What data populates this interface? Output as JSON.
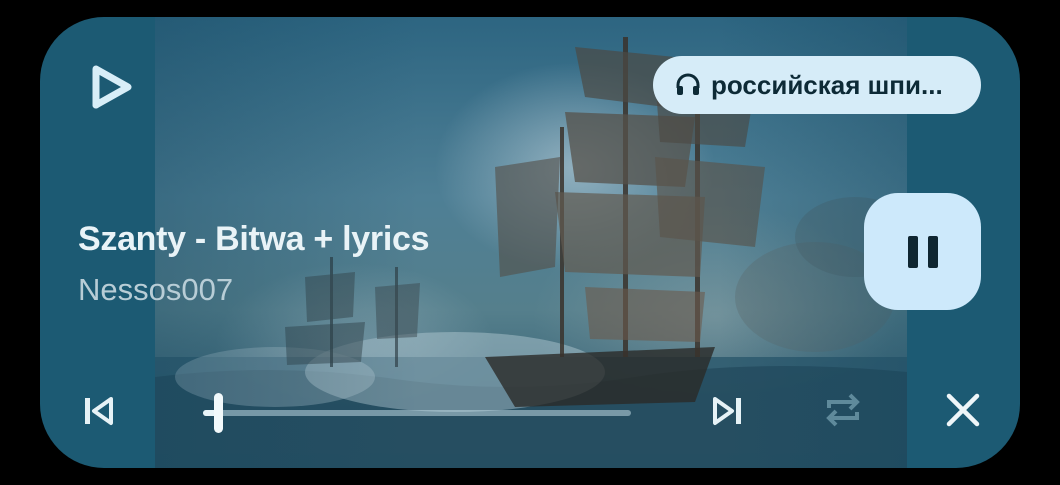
{
  "player": {
    "source_label": "российская шпи...",
    "title": "Szanty - Bitwa + lyrics",
    "artist": "Nessos007",
    "progress_fraction": 0.035
  },
  "colors": {
    "card_background": "#1c5a73",
    "chip_background": "#d6ecf8",
    "pause_button_background": "#cde9fb",
    "title_text": "#e9f3f7",
    "artist_text": "#b8cdd6"
  },
  "icons": {
    "app_logo": "play-triangle-logo",
    "source_chip": "headphones-icon",
    "previous": "skip-previous-icon",
    "next": "skip-next-icon",
    "repeat": "repeat-icon",
    "close": "close-icon",
    "play_pause": "pause-icon"
  }
}
